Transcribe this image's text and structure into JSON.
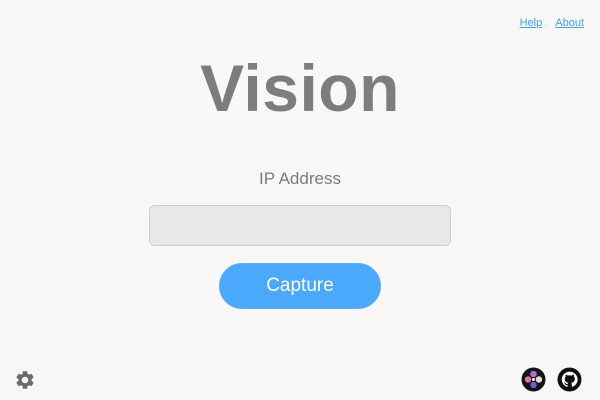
{
  "nav": {
    "help_label": "Help",
    "about_label": "About"
  },
  "main": {
    "title": "Vision",
    "ip_label": "IP Address",
    "ip_value": "",
    "ip_placeholder": "",
    "capture_label": "Capture"
  },
  "footer": {
    "settings_icon": "gear-icon",
    "extension_icon": "extension-logo-icon",
    "github_icon": "github-icon"
  },
  "colors": {
    "background": "#f9f7f8",
    "link": "#43a3e6",
    "title": "#7d7d7d",
    "button": "#4aa9fb",
    "input_bg": "#e8e8e8",
    "icon": "#6b6b6b"
  }
}
